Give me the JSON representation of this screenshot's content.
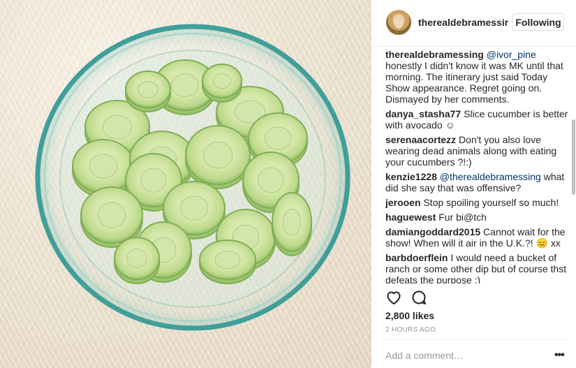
{
  "post": {
    "username": "therealdebramessir",
    "follow_label": "Following",
    "image_alt": "cucumber slices in a glass bowl"
  },
  "comments": [
    {
      "user": "therealdebramessing",
      "mention": "@ivor_pine",
      "text": " honestly I didn't know it was MK until that morning. The itinerary just said Today Show appearance. Regret going on. Dismayed by her comments."
    },
    {
      "user": "danya_stasha77",
      "mention": "",
      "text": " Slice cucumber is better with avocado ☺"
    },
    {
      "user": "serenaacortezz",
      "mention": "",
      "text": " Don't you also love wearing dead animals along with eating your cucumbers ?!:)"
    },
    {
      "user": "kenzie1228",
      "mention": "@therealdebramessing",
      "text": " what did she say that was offensive?"
    },
    {
      "user": "jerooen",
      "mention": "",
      "text": " Stop spoiling yourself so much!"
    },
    {
      "user": "haguewest",
      "mention": "",
      "text": " Fur bi@tch"
    },
    {
      "user": "damiangoddard2015",
      "mention": "",
      "text": " Cannot wait for the show! When will it air in the U.K.?! 😑 xx"
    },
    {
      "user": "barbdoerflein",
      "mention": "",
      "text": " I would need a bucket of ranch or some other dip but of course thst defeats the purpose :)"
    }
  ],
  "actions": {
    "like_icon": "heart-icon",
    "comment_icon": "comment-icon"
  },
  "likes": "2,800 likes",
  "time_ago": "2 HOURS AGO",
  "add_comment_placeholder": "Add a comment…",
  "more_label": "•••",
  "colors": {
    "mention": "#003569",
    "bowl_rim": "#3fa3a0",
    "cucumber": "#c7de9a"
  }
}
